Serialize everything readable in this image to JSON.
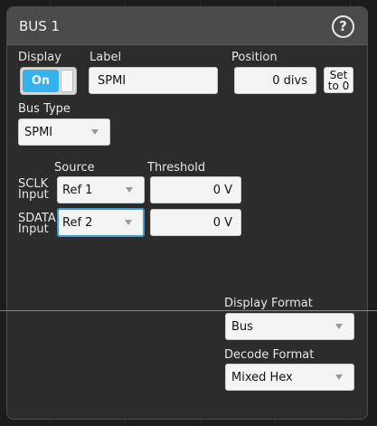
{
  "title": "BUS 1",
  "help_glyph": "?",
  "display": {
    "label": "Display",
    "state": "On"
  },
  "label_field": {
    "label": "Label",
    "value": "SPMI"
  },
  "position": {
    "label": "Position",
    "value": "0 divs",
    "set_line1": "Set",
    "set_line2": "to 0"
  },
  "bus_type": {
    "label": "Bus Type",
    "value": "SPMI"
  },
  "columns": {
    "source": "Source",
    "threshold": "Threshold"
  },
  "sclk": {
    "label_line1": "SCLK",
    "label_line2": "Input",
    "source": "Ref 1",
    "threshold": "0 V"
  },
  "sdata": {
    "label_line1": "SDATA",
    "label_line2": "Input",
    "source": "Ref 2",
    "threshold": "0 V"
  },
  "display_format": {
    "label": "Display Format",
    "value": "Bus"
  },
  "decode_format": {
    "label": "Decode Format",
    "value": "Mixed Hex"
  },
  "colors": {
    "accent": "#34b2ee",
    "selection": "#3c9be0",
    "cursor_line": "#d84bd8"
  }
}
